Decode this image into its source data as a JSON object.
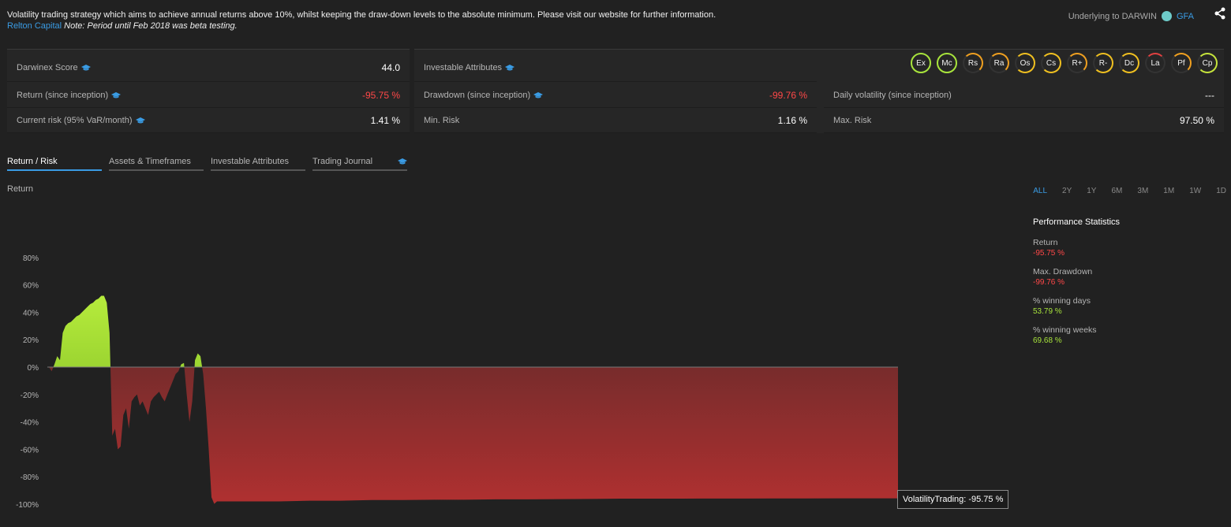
{
  "description": {
    "text": "Volatility trading strategy which aims to achieve annual returns above 10%, whilst keeping the draw-down levels to the absolute minimum. Please visit our website for further information.",
    "link": "Relton Capital",
    "note": "Note: Period until Feb 2018 was beta testing."
  },
  "underlying": {
    "label": "Underlying to DARWIN",
    "code": "GFA",
    "dot_color": "#6ecbc9"
  },
  "stats": {
    "score_label": "Darwinex Score",
    "score_value": "44.0",
    "attr_label": "Investable Attributes",
    "return_label": "Return (since inception)",
    "return_value": "-95.75 %",
    "drawdown_label": "Drawdown (since inception)",
    "drawdown_value": "-99.76 %",
    "volatility_label": "Daily volatility (since inception)",
    "volatility_value": "---",
    "risk_label": "Current risk (95% VaR/month)",
    "risk_value": "1.41 %",
    "minrisk_label": "Min. Risk",
    "minrisk_value": "1.16 %",
    "maxrisk_label": "Max. Risk",
    "maxrisk_value": "97.50 %"
  },
  "badges": [
    "Ex",
    "Mc",
    "Rs",
    "Ra",
    "Os",
    "Cs",
    "R+",
    "R-",
    "Dc",
    "La",
    "Pf",
    "Cp"
  ],
  "tabs": [
    "Return / Risk",
    "Assets & Timeframes",
    "Investable Attributes",
    "Trading Journal"
  ],
  "chart_label": "Return",
  "ranges": [
    "ALL",
    "2Y",
    "1Y",
    "6M",
    "3M",
    "1M",
    "1W",
    "1D"
  ],
  "performance": {
    "title": "Performance Statistics",
    "return_label": "Return",
    "return_value": "-95.75 %",
    "drawdown_label": "Max. Drawdown",
    "drawdown_value": "-99.76 %",
    "windays_label": "% winning days",
    "windays_value": "53.79 %",
    "winweeks_label": "% winning weeks",
    "winweeks_value": "69.68 %"
  },
  "tooltip": "VolatilityTrading: -95.75 %",
  "colors": {
    "accent": "#3a9be3",
    "negative": "#ff4848",
    "positive": "#a8e43c"
  },
  "chart_data": {
    "type": "area",
    "yticks": [
      "80%",
      "60%",
      "40%",
      "20%",
      "0%",
      "-20%",
      "-40%",
      "-60%",
      "-80%",
      "-100%"
    ],
    "ylim": [
      -100,
      80
    ],
    "series": [
      {
        "name": "VolatilityTrading",
        "values": [
          0,
          -3,
          2,
          8,
          5,
          25,
          30,
          32,
          33,
          35,
          37,
          38,
          40,
          42,
          44,
          46,
          47,
          49,
          50,
          52,
          52,
          47,
          25,
          -50,
          -45,
          -60,
          -58,
          -35,
          -30,
          -45,
          -25,
          -22,
          -20,
          -28,
          -25,
          -30,
          -35,
          -25,
          -22,
          -20,
          -18,
          -22,
          -25,
          -20,
          -15,
          -10,
          -5,
          -3,
          2,
          3,
          -20,
          -40,
          -25,
          5,
          10,
          8,
          -5,
          -30,
          -60,
          -95,
          -99.76,
          -98,
          -98,
          -98,
          -97.5,
          -97.5,
          -97,
          -97,
          -96.8,
          -96.8,
          -96.5,
          -96.5,
          -96.3,
          -96.2,
          -96,
          -96,
          -96,
          -95.9,
          -95.9,
          -95.8,
          -95.8,
          -95.75,
          -95.75,
          -95.75
        ]
      }
    ]
  }
}
